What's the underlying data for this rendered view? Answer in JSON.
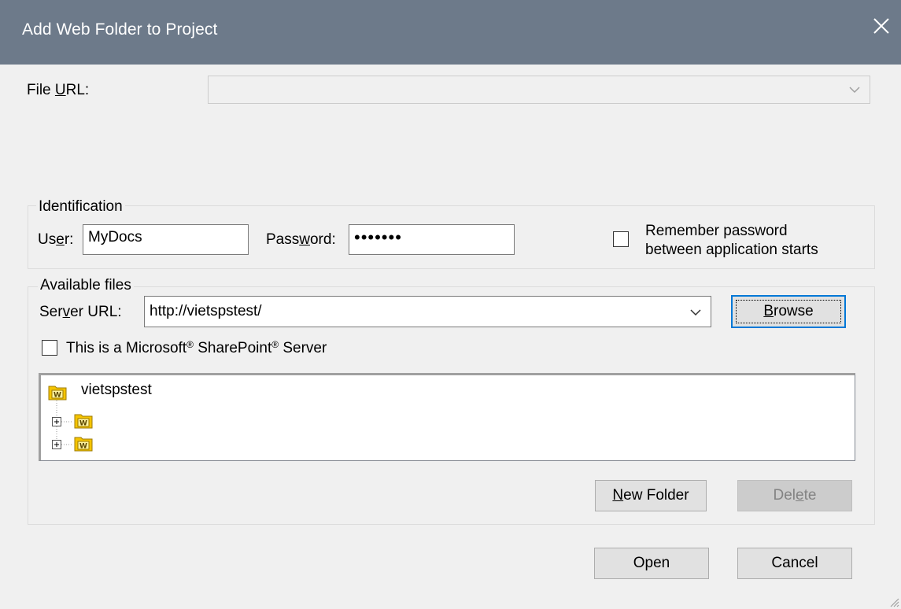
{
  "window": {
    "title": "Add Web Folder to Project",
    "close_icon": "close-icon"
  },
  "file_url": {
    "label_pre": "File ",
    "label_u": "U",
    "label_post": "RL:",
    "value": ""
  },
  "identification": {
    "group_title": "Identification",
    "user_label_pre": "Us",
    "user_label_u": "e",
    "user_label_post": "r:",
    "user_value": "MyDocs",
    "password_label_pre": "Pass",
    "password_label_u": "w",
    "password_label_post": "ord:",
    "password_value": "•••••••",
    "remember_line1": "Remember password",
    "remember_line2": "between application starts",
    "remember_checked": false
  },
  "available_files": {
    "group_title": "Available files",
    "server_url_label_pre": "Ser",
    "server_url_label_u": "v",
    "server_url_label_post": "er URL:",
    "server_url_value": "http://vietspstest/",
    "browse_label_u": "B",
    "browse_label_post": "rowse",
    "sharepoint_pre": "This is a Microsoft",
    "sharepoint_mid": " SharePoint",
    "sharepoint_post": " Server",
    "registered": "®",
    "sharepoint_checked": false,
    "tree": {
      "root": "vietspstest",
      "children": [
        "",
        ""
      ]
    },
    "new_folder_label_u": "N",
    "new_folder_label_post": "ew Folder",
    "delete_label_pre": "Del",
    "delete_label_u": "e",
    "delete_label_post": "te"
  },
  "buttons": {
    "open": "Open",
    "cancel": "Cancel"
  },
  "colors": {
    "titlebar": "#6d7a8a",
    "accent": "#0078d7",
    "dialog_bg": "#f0f0f0",
    "folder": "#f5c400"
  }
}
